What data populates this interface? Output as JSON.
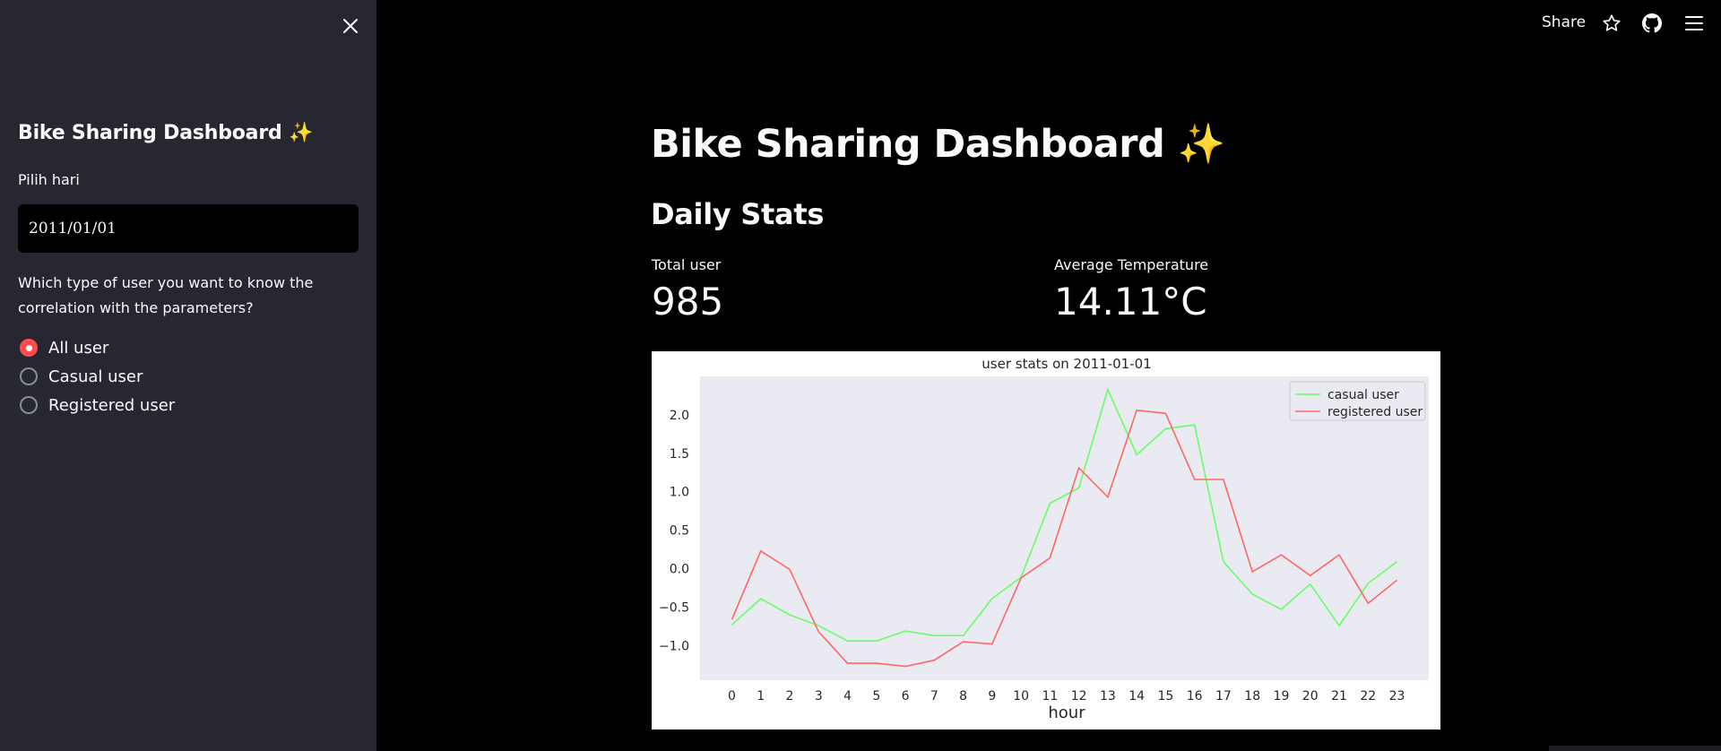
{
  "sidebar": {
    "title": "Bike Sharing Dashboard ✨",
    "date_label": "Pilih hari",
    "date_value": "2011/01/01",
    "question": "Which type of user you want to know the correlation with the parameters?",
    "radio_options": [
      "All user",
      "Casual user",
      "Registered user"
    ],
    "selected_option": "All user"
  },
  "header": {
    "share_label": "Share"
  },
  "main": {
    "title": "Bike Sharing Dashboard ✨",
    "subheader": "Daily Stats",
    "metrics": [
      {
        "label": "Total user",
        "value": "985"
      },
      {
        "label": "Average Temperature",
        "value": "14.11°C"
      }
    ]
  },
  "colors": {
    "sidebar_bg": "#262730",
    "accent": "#ff4b4b",
    "plot_bg": "#eaeaf2",
    "casual_line": "#66ff66",
    "registered_line": "#ff6666"
  },
  "chart_data": {
    "type": "line",
    "title": "user stats on 2011-01-01",
    "xlabel": "hour",
    "ylabel": "",
    "x": [
      0,
      1,
      2,
      3,
      4,
      5,
      6,
      7,
      8,
      9,
      10,
      11,
      12,
      13,
      14,
      15,
      16,
      17,
      18,
      19,
      20,
      21,
      22,
      23
    ],
    "series": [
      {
        "name": "casual user",
        "color": "#66ff66",
        "values": [
          -0.73,
          -0.39,
          -0.6,
          -0.74,
          -0.94,
          -0.94,
          -0.81,
          -0.87,
          -0.87,
          -0.39,
          -0.11,
          0.85,
          1.05,
          2.33,
          1.48,
          1.82,
          1.87,
          0.09,
          -0.33,
          -0.53,
          -0.2,
          -0.74,
          -0.19,
          0.09
        ]
      },
      {
        "name": "registered user",
        "color": "#ff6666",
        "values": [
          -0.66,
          0.23,
          -0.01,
          -0.82,
          -1.23,
          -1.23,
          -1.27,
          -1.19,
          -0.95,
          -0.98,
          -0.12,
          0.14,
          1.31,
          0.93,
          2.06,
          2.02,
          1.16,
          1.16,
          -0.04,
          0.18,
          -0.09,
          0.18,
          -0.45,
          -0.15
        ]
      }
    ],
    "yticks": [
      2.0,
      1.5,
      1.0,
      0.5,
      0.0,
      -0.5,
      -1.0
    ],
    "ytick_labels": [
      "2.0",
      "1.5",
      "1.0",
      "0.5",
      "0.0",
      "−0.5",
      "−1.0"
    ],
    "ylim": [
      -1.45,
      2.5
    ],
    "xlim": [
      -1.1,
      24.1
    ],
    "legend": "top-right",
    "grid": false
  }
}
